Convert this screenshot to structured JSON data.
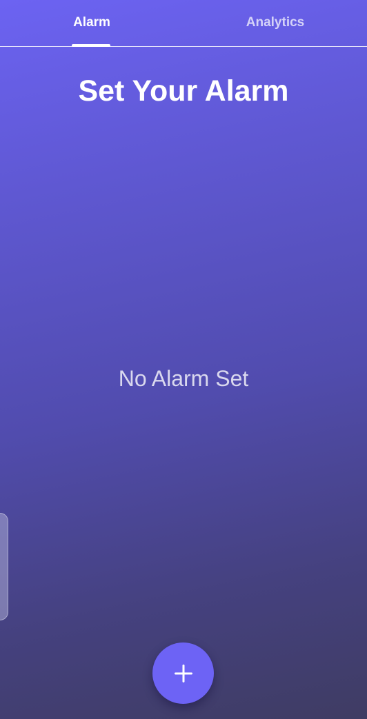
{
  "tabs": {
    "alarm_label": "Alarm",
    "analytics_label": "Analytics",
    "active": "Alarm"
  },
  "main": {
    "title": "Set Your Alarm",
    "empty_message": "No Alarm Set"
  },
  "fab": {
    "icon": "plus-icon"
  },
  "colors": {
    "accent": "#6d63f5",
    "gradient_top": "#6c63f2",
    "gradient_bottom": "#3f3c63",
    "text": "#ffffff"
  }
}
